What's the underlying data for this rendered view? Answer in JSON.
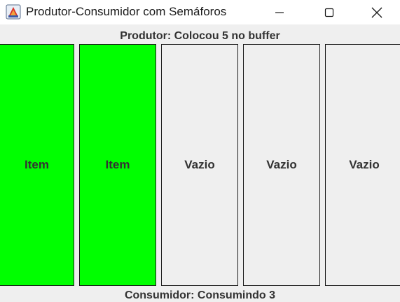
{
  "window": {
    "title": "Produtor-Consumidor com Semáforos",
    "icon": "java-app-icon",
    "controls": {
      "minimize": "minimize-icon",
      "maximize": "maximize-icon",
      "close": "close-icon"
    }
  },
  "producer_status": "Produtor: Colocou 5 no buffer",
  "consumer_status": "Consumidor: Consumindo 3",
  "buffer": {
    "slots": [
      {
        "label": "Item",
        "color": "#00ff00"
      },
      {
        "label": "Item",
        "color": "#00ff00"
      },
      {
        "label": "Vazio",
        "color": "#efefef"
      },
      {
        "label": "Vazio",
        "color": "#efefef"
      },
      {
        "label": "Vazio",
        "color": "#efefef"
      }
    ]
  }
}
